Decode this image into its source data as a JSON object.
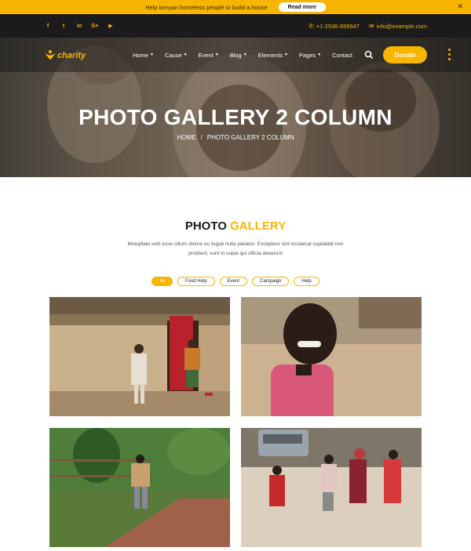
{
  "announcement": {
    "text": "Help kenyan homeless people to build a house",
    "button": "Read more",
    "close": "✕"
  },
  "topbar": {
    "socials": [
      {
        "icon": "facebook-icon",
        "glyph": "f"
      },
      {
        "icon": "twitter-icon",
        "glyph": "t"
      },
      {
        "icon": "linkedin-icon",
        "glyph": "in"
      },
      {
        "icon": "google-plus-icon",
        "glyph": "G+"
      },
      {
        "icon": "youtube-icon",
        "glyph": "▶"
      }
    ],
    "phone": "+1-2536-859647",
    "email": "info@example.com"
  },
  "header": {
    "logo_text": "charity",
    "nav": [
      "Home",
      "Cause",
      "Event",
      "Blog",
      "Elements",
      "Pages",
      "Contact"
    ],
    "nav_has_caret": [
      true,
      true,
      true,
      true,
      true,
      true,
      false
    ],
    "donate": "Donate"
  },
  "hero": {
    "title": "PHOTO GALLERY 2 COLUMN",
    "breadcrumb_home": "HOME",
    "breadcrumb_sep": "/",
    "breadcrumb_current": "PHOTO GALLERY 2 COLUMN"
  },
  "gallery": {
    "title_part1": "PHOTO",
    "title_part2": "GALLERY",
    "description": "Moluptate velit esse cillum dolore eu fugiat nulla pariatur. Excepteur sint occaecat cupidatat non proident, sunt in culpa qui officia deserunt",
    "filters": [
      "All",
      "Food Help",
      "Event",
      "Campaign",
      "Help"
    ],
    "active_filter": "All"
  },
  "colors": {
    "accent": "#f7b500",
    "dark": "#1b1b1b"
  }
}
